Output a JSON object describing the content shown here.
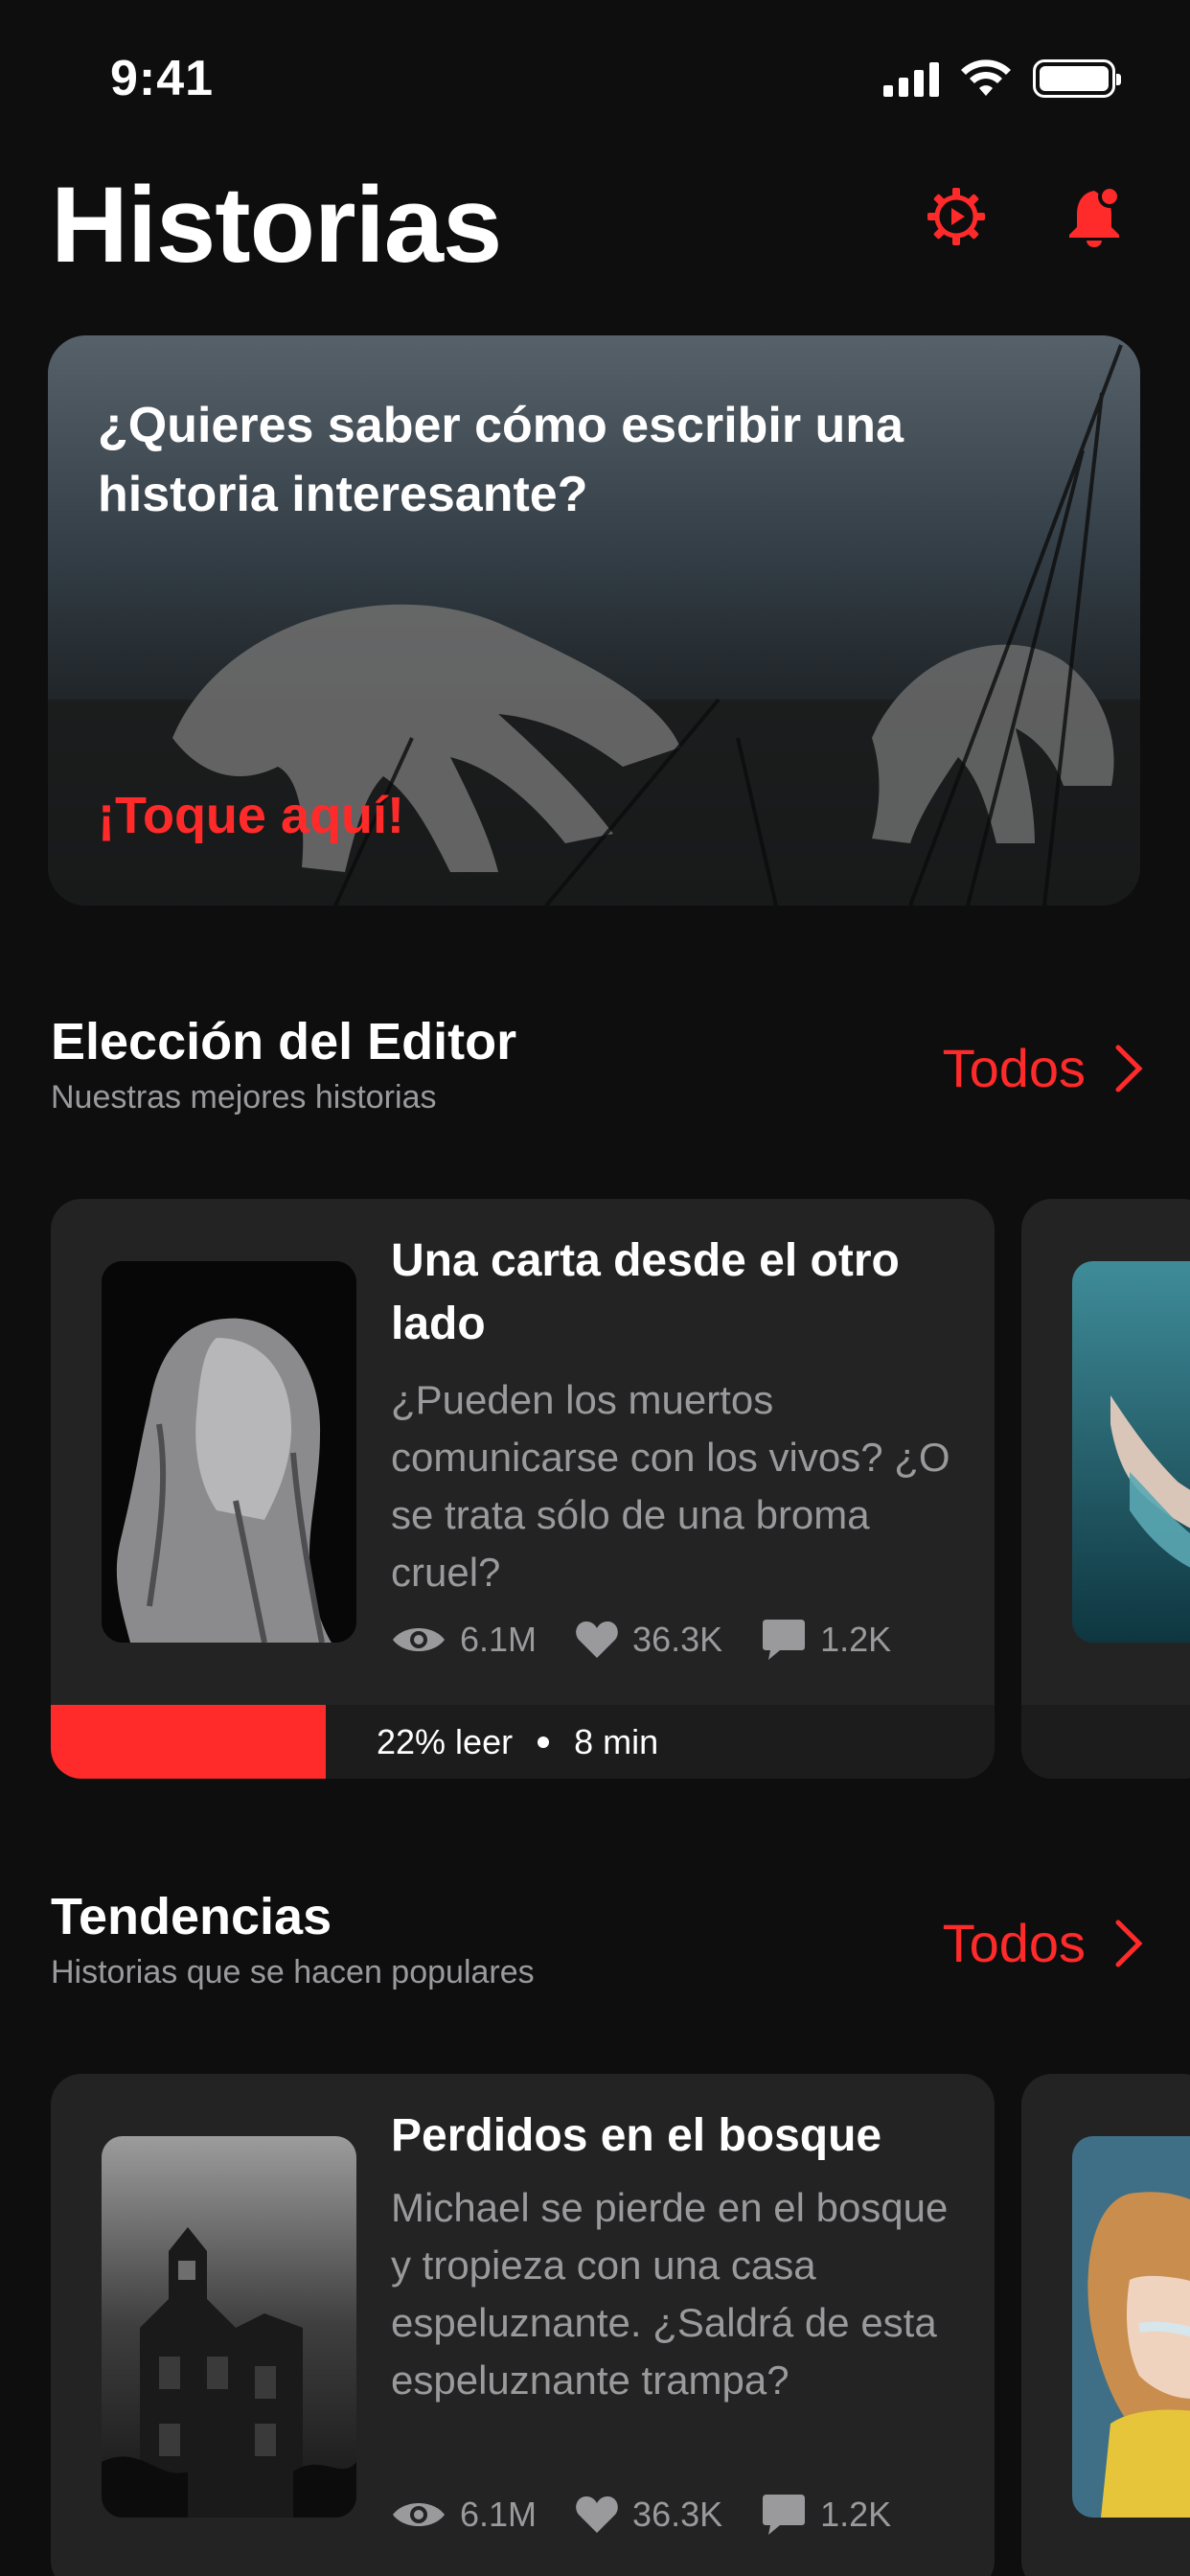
{
  "status_bar": {
    "time": "9:41"
  },
  "header": {
    "title": "Historias"
  },
  "hero": {
    "title": "¿Quieres saber cómo escribir una historia interesante?",
    "cta": "¡Toque aquí!"
  },
  "editors_choice": {
    "title": "Elección del Editor",
    "subtitle": "Nuestras mejores historias",
    "see_all": "Todos",
    "card": {
      "title": "Una carta desde el otro lado",
      "description": "¿Pueden los muertos comunicarse con los vivos? ¿O se trata sólo de una broma cruel?",
      "views": "6.1M",
      "likes": "36.3K",
      "comments": "1.2K",
      "progress_percent": 22,
      "progress_label": "22% leer",
      "duration": "8 min"
    }
  },
  "trending": {
    "title": "Tendencias",
    "subtitle": "Historias que se hacen populares",
    "see_all": "Todos",
    "card": {
      "title": "Perdidos en el bosque",
      "description": "Michael se pierde en el bosque y tropieza con una casa espeluznante. ¿Saldrá de esta espeluznante trampa?",
      "views": "6.1M",
      "likes": "36.3K",
      "comments": "1.2K"
    }
  },
  "colors": {
    "accent": "#ff2a2a",
    "background": "#0f0e0f",
    "card": "#232324",
    "muted": "#9a9a9d"
  }
}
